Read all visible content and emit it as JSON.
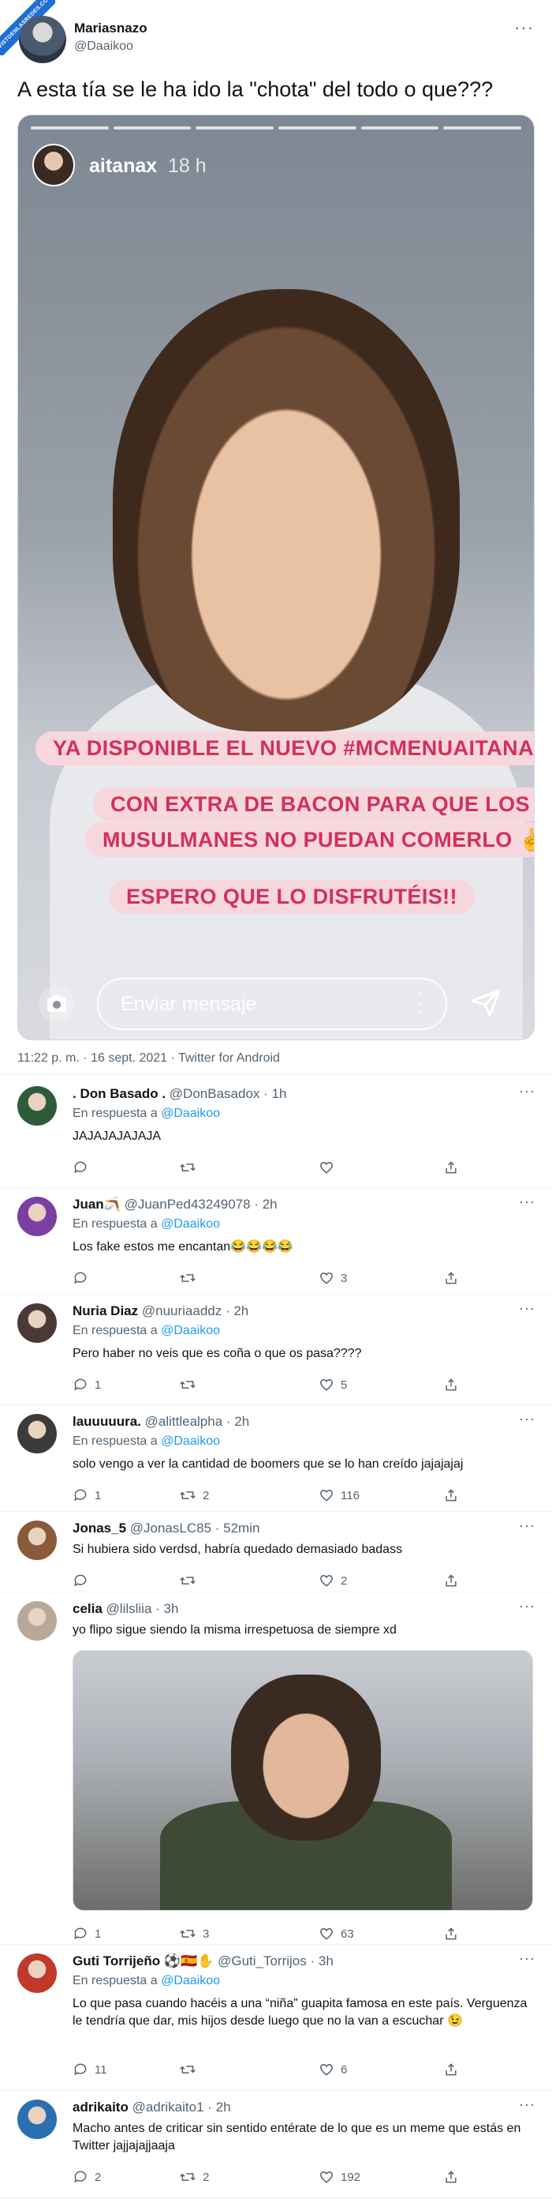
{
  "watermark": "VISTOENLASREDES.COM",
  "tweet": {
    "name": "Mariasnazo",
    "handle": "@Daaikoo",
    "text": "A esta tía se le ha ido la \"chota\" del todo o que???",
    "meta": "11:22 p. m. · 16 sept. 2021 · Twitter for Android"
  },
  "story": {
    "username": "aitanax",
    "time": "18 h",
    "captions": [
      "YA DISPONIBLE EL NUEVO #MCMENUAITANA",
      "CON EXTRA DE BACON PARA QUE LOS",
      "MUSULMANES NO PUEDAN COMERLO ✌",
      "ESPERO QUE LO DISFRUTÉIS!!"
    ],
    "message_placeholder": "Enviar mensaje"
  },
  "reply_prefix": "En respuesta a",
  "reply_to": "@Daaikoo",
  "replies": [
    {
      "name": ". Don Basado .",
      "handle": "@DonBasadox",
      "time": "· 1h",
      "text": "JAJAJAJAJAJA",
      "comments": "",
      "retweets": "",
      "likes": "",
      "avatar_color": "#2e5b3a",
      "show_resp": true
    },
    {
      "name": "Juan🪃",
      "handle": "@JuanPed43249078",
      "time": "· 2h",
      "text": "Los fake estos me encantan😂😂😂😂",
      "comments": "",
      "retweets": "",
      "likes": "3",
      "avatar_color": "#7b3fa3",
      "show_resp": true
    },
    {
      "name": "Nuria Diaz",
      "handle": "@nuuriaaddz",
      "time": "· 2h",
      "text": "Pero haber no veis que es coña o que os pasa????",
      "comments": "1",
      "retweets": "",
      "likes": "5",
      "avatar_color": "#4a3a35",
      "show_resp": true
    },
    {
      "name": "lauuuuura.",
      "handle": "@alittlealpha",
      "time": "· 2h",
      "text": "solo vengo a ver la cantidad de boomers que se lo han creído jajajajaj",
      "comments": "1",
      "retweets": "2",
      "likes": "116",
      "avatar_color": "#3b3b3b",
      "show_resp": true
    },
    {
      "name": "Jonas_5",
      "handle": "@JonasLC85",
      "time": "· 52min",
      "text": "Si hubiera sido verdsd, habría quedado demasiado badass",
      "comments": "",
      "retweets": "",
      "likes": "2",
      "avatar_color": "#8a5a3a",
      "show_resp": false
    },
    {
      "name": "celia",
      "handle": "@lilsliia",
      "time": "· 3h",
      "text": "yo flipo sigue siendo la misma irrespetuosa de siempre xd",
      "comments": "1",
      "retweets": "3",
      "likes": "63",
      "avatar_color": "#b8a89a",
      "show_resp": false
    },
    {
      "name": "Guti Torrijeño ⚽🇪🇸✋",
      "handle": "@Guti_Torrijos",
      "time": "· 3h",
      "text": "Lo que pasa cuando hacéis a una “niña” guapita famosa en este país. Verguenza le tendría que dar, mis hijos desde luego que no la van a escuchar 😉",
      "comments": "11",
      "retweets": "",
      "likes": "6",
      "avatar_color": "#c0392b",
      "show_resp": true
    },
    {
      "name": "adrikaito",
      "handle": "@adrikaito1",
      "time": "· 2h",
      "text": "Macho antes de criticar sin sentido entérate de lo que es un meme que estás en Twitter  jajjajajjaaja",
      "comments": "2",
      "retweets": "2",
      "likes": "192",
      "avatar_color": "#2a6fb0",
      "show_resp": false
    }
  ]
}
